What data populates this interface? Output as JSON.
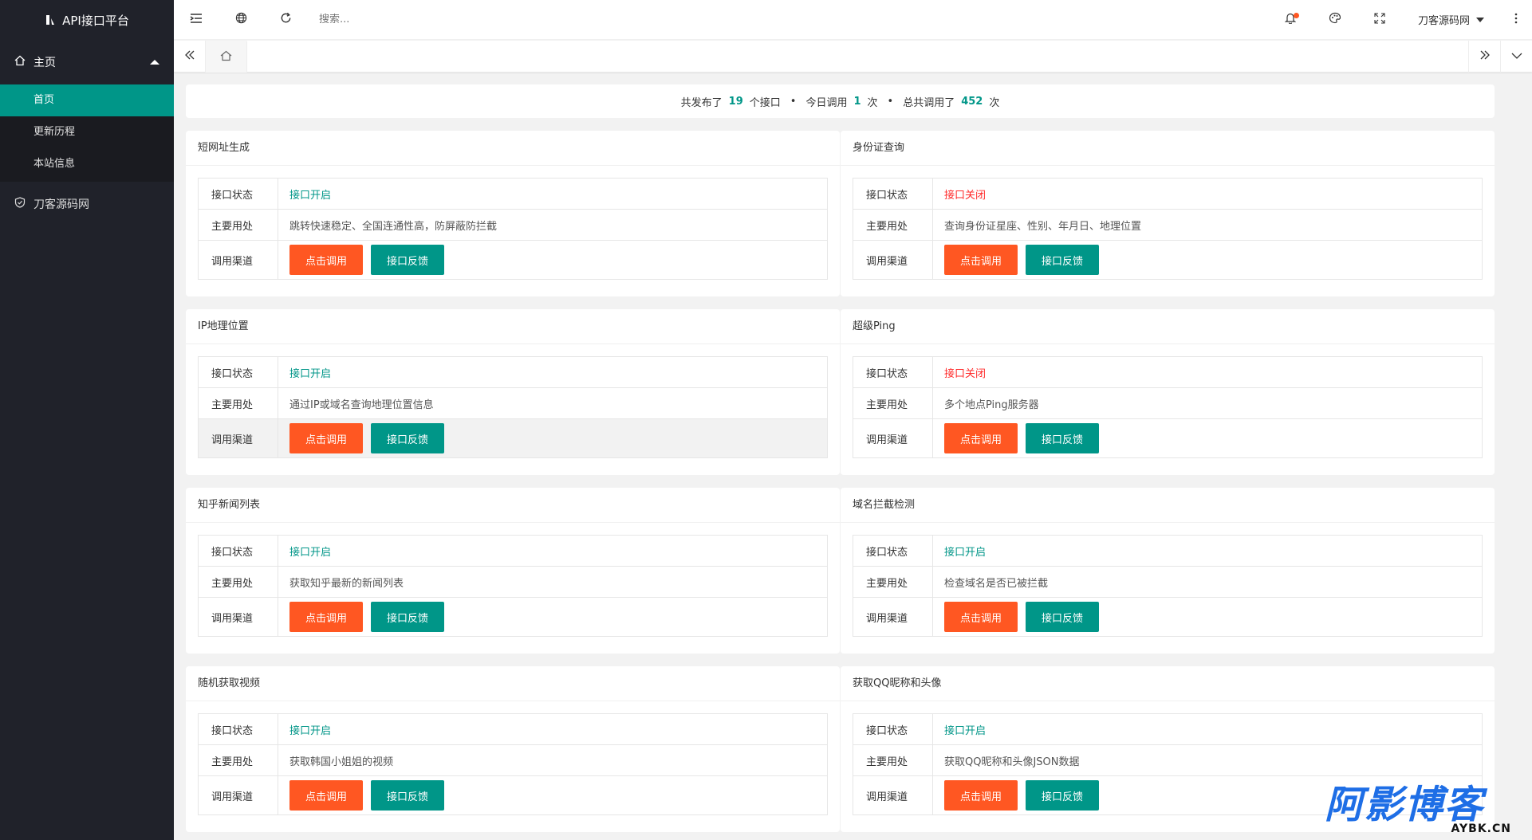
{
  "app": {
    "title": "API接口平台"
  },
  "sidebar": {
    "group_label": "主页",
    "sub_items": [
      {
        "label": "首页",
        "active": true
      },
      {
        "label": "更新历程",
        "active": false
      },
      {
        "label": "本站信息",
        "active": false
      }
    ],
    "extra_item": "刀客源码网"
  },
  "header": {
    "search_placeholder": "搜索...",
    "user_name": "刀客源码网"
  },
  "stats": {
    "prefix": "共发布了",
    "total_apis": "19",
    "apis_unit": "个接口",
    "today_prefix": "今日调用",
    "today_calls": "1",
    "today_unit": "次",
    "total_prefix": "总共调用了",
    "total_calls": "452",
    "total_unit": "次"
  },
  "labels": {
    "status": "接口状态",
    "usage": "主要用处",
    "channel": "调用渠道",
    "call_button": "点击调用",
    "feedback_button": "接口反馈"
  },
  "cards": [
    {
      "title": "短网址生成",
      "status": "接口开启",
      "usage": "跳转快速稳定、全国连通性高，防屏蔽防拦截"
    },
    {
      "title": "身份证查询",
      "status": "接口关闭",
      "usage": "查询身份证星座、性别、年月日、地理位置"
    },
    {
      "title": "IP地理位置",
      "status": "接口开启",
      "usage": "通过IP或域名查询地理位置信息"
    },
    {
      "title": "超级Ping",
      "status": "接口关闭",
      "usage": "多个地点Ping服务器"
    },
    {
      "title": "知乎新闻列表",
      "status": "接口开启",
      "usage": "获取知乎最新的新闻列表"
    },
    {
      "title": "域名拦截检测",
      "status": "接口开启",
      "usage": "检查域名是否已被拦截"
    },
    {
      "title": "随机获取视频",
      "status": "接口开启",
      "usage": "获取韩国小姐姐的视频"
    },
    {
      "title": "获取QQ昵称和头像",
      "status": "接口开启",
      "usage": "获取QQ昵称和头像JSON数据"
    }
  ],
  "colors": {
    "accent": "#009688",
    "orange": "#ff5722",
    "danger": "#ff2a2a",
    "sidebar_bg": "#20222a"
  },
  "watermark": {
    "cn": "阿影博客",
    "en": "AYBK.CN"
  }
}
